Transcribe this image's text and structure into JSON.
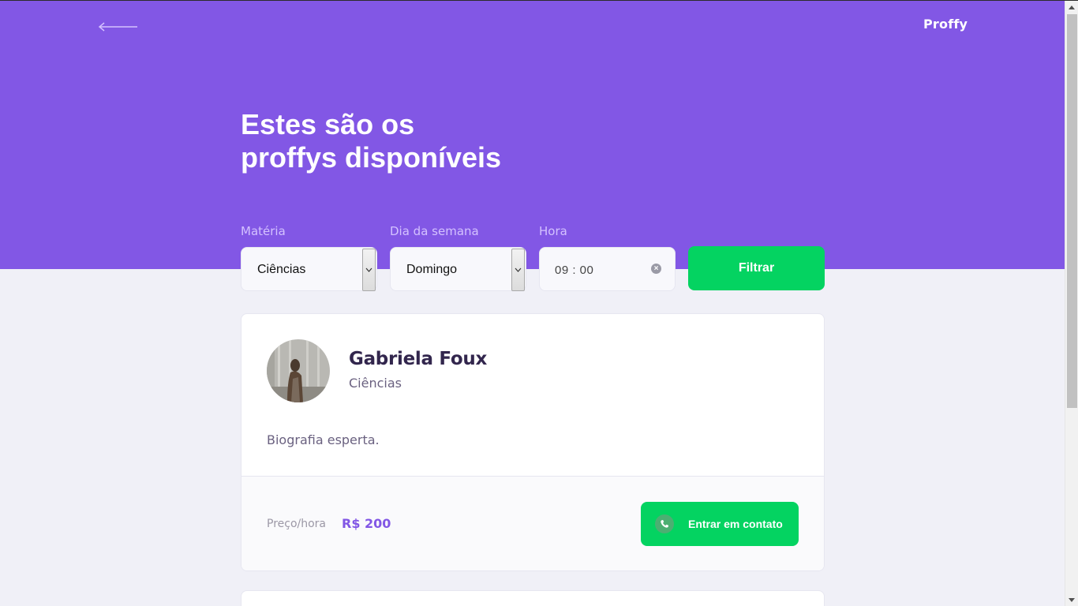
{
  "header": {
    "logo": "Proffy",
    "title_line1": "Estes são os",
    "title_line2": "proffys disponíveis"
  },
  "filters": {
    "subject_label": "Matéria",
    "subject_value": "Ciências",
    "weekday_label": "Dia da semana",
    "weekday_value": "Domingo",
    "time_label": "Hora",
    "time_value": "09 : 00",
    "submit_label": "Filtrar"
  },
  "teachers": [
    {
      "name": "Gabriela Foux",
      "subject": "Ciências",
      "bio": "Biografia esperta.",
      "price_label": "Preço/hora",
      "price": "R$ 200",
      "contact_label": "Entrar em contato"
    }
  ],
  "colors": {
    "primary": "#8257e5",
    "secondary": "#04d361",
    "background": "#f0f0f7",
    "title_text": "#32264d",
    "body_text": "#6a6180"
  },
  "icons": [
    "back-arrow-icon",
    "chevron-down-icon",
    "clear-icon",
    "whatsapp-icon"
  ]
}
